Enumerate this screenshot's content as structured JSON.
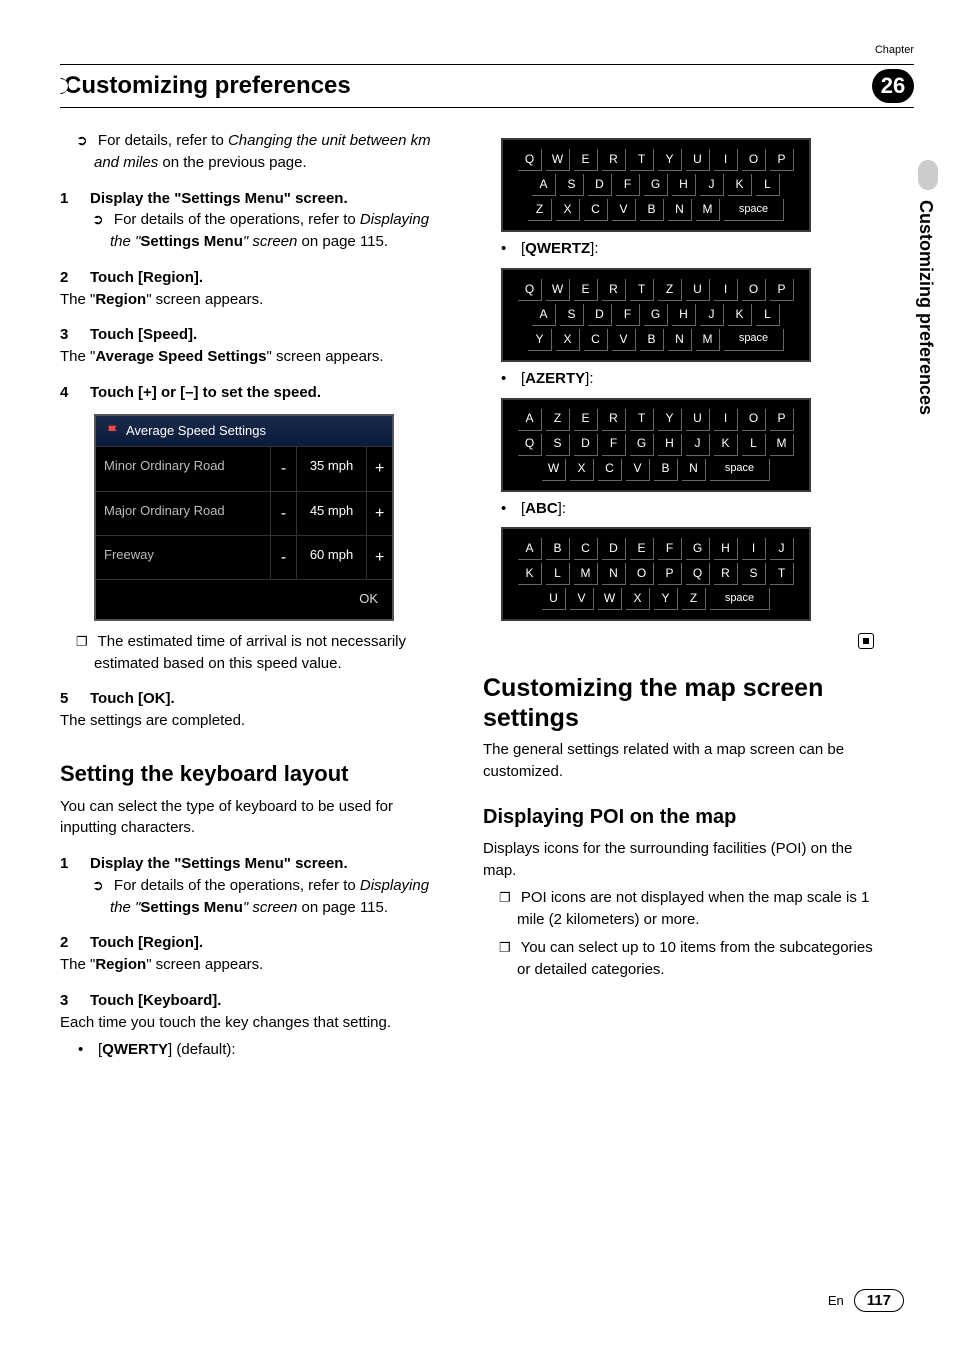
{
  "chapter": {
    "label": "Chapter",
    "num": "26",
    "title": "Customizing preferences"
  },
  "side_tab": "Customizing preferences",
  "left": {
    "intro_ref": {
      "pre": "For details, refer to ",
      "link": "Changing the unit between km and miles",
      "post": " on the previous page."
    },
    "s1": {
      "num": "1",
      "text": "Display the \"Settings Menu\" screen."
    },
    "s1_ref": {
      "pre": "For details of the operations, refer to ",
      "link1": "Displaying the \"",
      "bold": "Settings Menu",
      "link2": "\" screen",
      "post": " on page 115."
    },
    "s2": {
      "num": "2",
      "text": "Touch [Region]."
    },
    "s2_body": {
      "pre": "The \"",
      "bold": "Region",
      "post": "\" screen appears."
    },
    "s3": {
      "num": "3",
      "text": "Touch [Speed]."
    },
    "s3_body": {
      "pre": "The \"",
      "bold": "Average Speed Settings",
      "post": "\" screen appears."
    },
    "s4": {
      "num": "4",
      "text": "Touch [+] or [–] to set the speed."
    },
    "speed": {
      "title": "Average Speed Settings",
      "rows": [
        {
          "label": "Minor Ordinary Road",
          "val": "35 mph"
        },
        {
          "label": "Major Ordinary Road",
          "val": "45 mph"
        },
        {
          "label": "Freeway",
          "val": "60 mph"
        }
      ],
      "ok": "OK"
    },
    "s4_note": "The estimated time of arrival is not necessarily estimated based on this speed value.",
    "s5": {
      "num": "5",
      "text": "Touch [OK]."
    },
    "s5_body": "The settings are completed.",
    "kbd_h": "Setting the keyboard layout",
    "kbd_intro": "You can select the type of keyboard to be used for inputting characters.",
    "k1": {
      "num": "1",
      "text": "Display the \"Settings Menu\" screen."
    },
    "k1_ref": {
      "pre": "For details of the operations, refer to ",
      "link1": "Displaying the \"",
      "bold": "Settings Menu",
      "link2": "\" screen",
      "post": " on page 115."
    },
    "k2": {
      "num": "2",
      "text": "Touch [Region]."
    },
    "k2_body": {
      "pre": "The \"",
      "bold": "Region",
      "post": "\" screen appears."
    },
    "k3": {
      "num": "3",
      "text": "Touch [Keyboard]."
    },
    "k3_body": "Each time you touch the key changes that setting.",
    "k3_opt": {
      "label": "QWERTY",
      "suffix": " (default):"
    }
  },
  "right": {
    "opts": [
      {
        "label": "QWERTZ"
      },
      {
        "label": "AZERTY"
      },
      {
        "label": "ABC"
      }
    ],
    "kbd_qwerty": [
      [
        "Q",
        "W",
        "E",
        "R",
        "T",
        "Y",
        "U",
        "I",
        "O",
        "P"
      ],
      [
        "A",
        "S",
        "D",
        "F",
        "G",
        "H",
        "J",
        "K",
        "L"
      ],
      [
        "Z",
        "X",
        "C",
        "V",
        "B",
        "N",
        "M",
        "space"
      ]
    ],
    "kbd_qwertz": [
      [
        "Q",
        "W",
        "E",
        "R",
        "T",
        "Z",
        "U",
        "I",
        "O",
        "P"
      ],
      [
        "A",
        "S",
        "D",
        "F",
        "G",
        "H",
        "J",
        "K",
        "L"
      ],
      [
        "Y",
        "X",
        "C",
        "V",
        "B",
        "N",
        "M",
        "space"
      ]
    ],
    "kbd_azerty": [
      [
        "A",
        "Z",
        "E",
        "R",
        "T",
        "Y",
        "U",
        "I",
        "O",
        "P"
      ],
      [
        "Q",
        "S",
        "D",
        "F",
        "G",
        "H",
        "J",
        "K",
        "L",
        "M"
      ],
      [
        "W",
        "X",
        "C",
        "V",
        "B",
        "N",
        "space"
      ]
    ],
    "kbd_abc": [
      [
        "A",
        "B",
        "C",
        "D",
        "E",
        "F",
        "G",
        "H",
        "I",
        "J"
      ],
      [
        "K",
        "L",
        "M",
        "N",
        "O",
        "P",
        "Q",
        "R",
        "S",
        "T"
      ],
      [
        "U",
        "V",
        "W",
        "X",
        "Y",
        "Z",
        "space"
      ]
    ],
    "map_h": "Customizing the map screen settings",
    "map_intro": "The general settings related with a map screen can be customized.",
    "poi_h": "Displaying POI on the map",
    "poi_intro": "Displays icons for the surrounding facilities (POI) on the map.",
    "poi_n1": "POI icons are not displayed when the map scale is 1 mile (2 kilometers) or more.",
    "poi_n2": "You can select up to 10 items from the subcategories or detailed categories."
  },
  "footer": {
    "lang": "En",
    "page": "117"
  }
}
